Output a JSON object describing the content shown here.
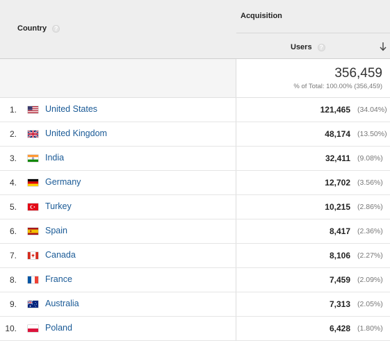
{
  "header": {
    "country_label": "Country",
    "acquisition_label": "Acquisition",
    "users_label": "Users",
    "help_glyph": "?"
  },
  "totals": {
    "value": "356,459",
    "subtitle": "% of Total: 100.00% (356,459)"
  },
  "rows": [
    {
      "index": "1.",
      "country": "United States",
      "users": "121,465",
      "pct": "(34.04%)",
      "flag": "us-flag-icon"
    },
    {
      "index": "2.",
      "country": "United Kingdom",
      "users": "48,174",
      "pct": "(13.50%)",
      "flag": "uk-flag-icon"
    },
    {
      "index": "3.",
      "country": "India",
      "users": "32,411",
      "pct": "(9.08%)",
      "flag": "india-flag-icon"
    },
    {
      "index": "4.",
      "country": "Germany",
      "users": "12,702",
      "pct": "(3.56%)",
      "flag": "germany-flag-icon"
    },
    {
      "index": "5.",
      "country": "Turkey",
      "users": "10,215",
      "pct": "(2.86%)",
      "flag": "turkey-flag-icon"
    },
    {
      "index": "6.",
      "country": "Spain",
      "users": "8,417",
      "pct": "(2.36%)",
      "flag": "spain-flag-icon"
    },
    {
      "index": "7.",
      "country": "Canada",
      "users": "8,106",
      "pct": "(2.27%)",
      "flag": "canada-flag-icon"
    },
    {
      "index": "8.",
      "country": "France",
      "users": "7,459",
      "pct": "(2.09%)",
      "flag": "france-flag-icon"
    },
    {
      "index": "9.",
      "country": "Australia",
      "users": "7,313",
      "pct": "(2.05%)",
      "flag": "australia-flag-icon"
    },
    {
      "index": "10.",
      "country": "Poland",
      "users": "6,428",
      "pct": "(1.80%)",
      "flag": "poland-flag-icon"
    }
  ],
  "colors": {
    "link": "#1a5a96",
    "header_bg": "#eeeeee"
  }
}
